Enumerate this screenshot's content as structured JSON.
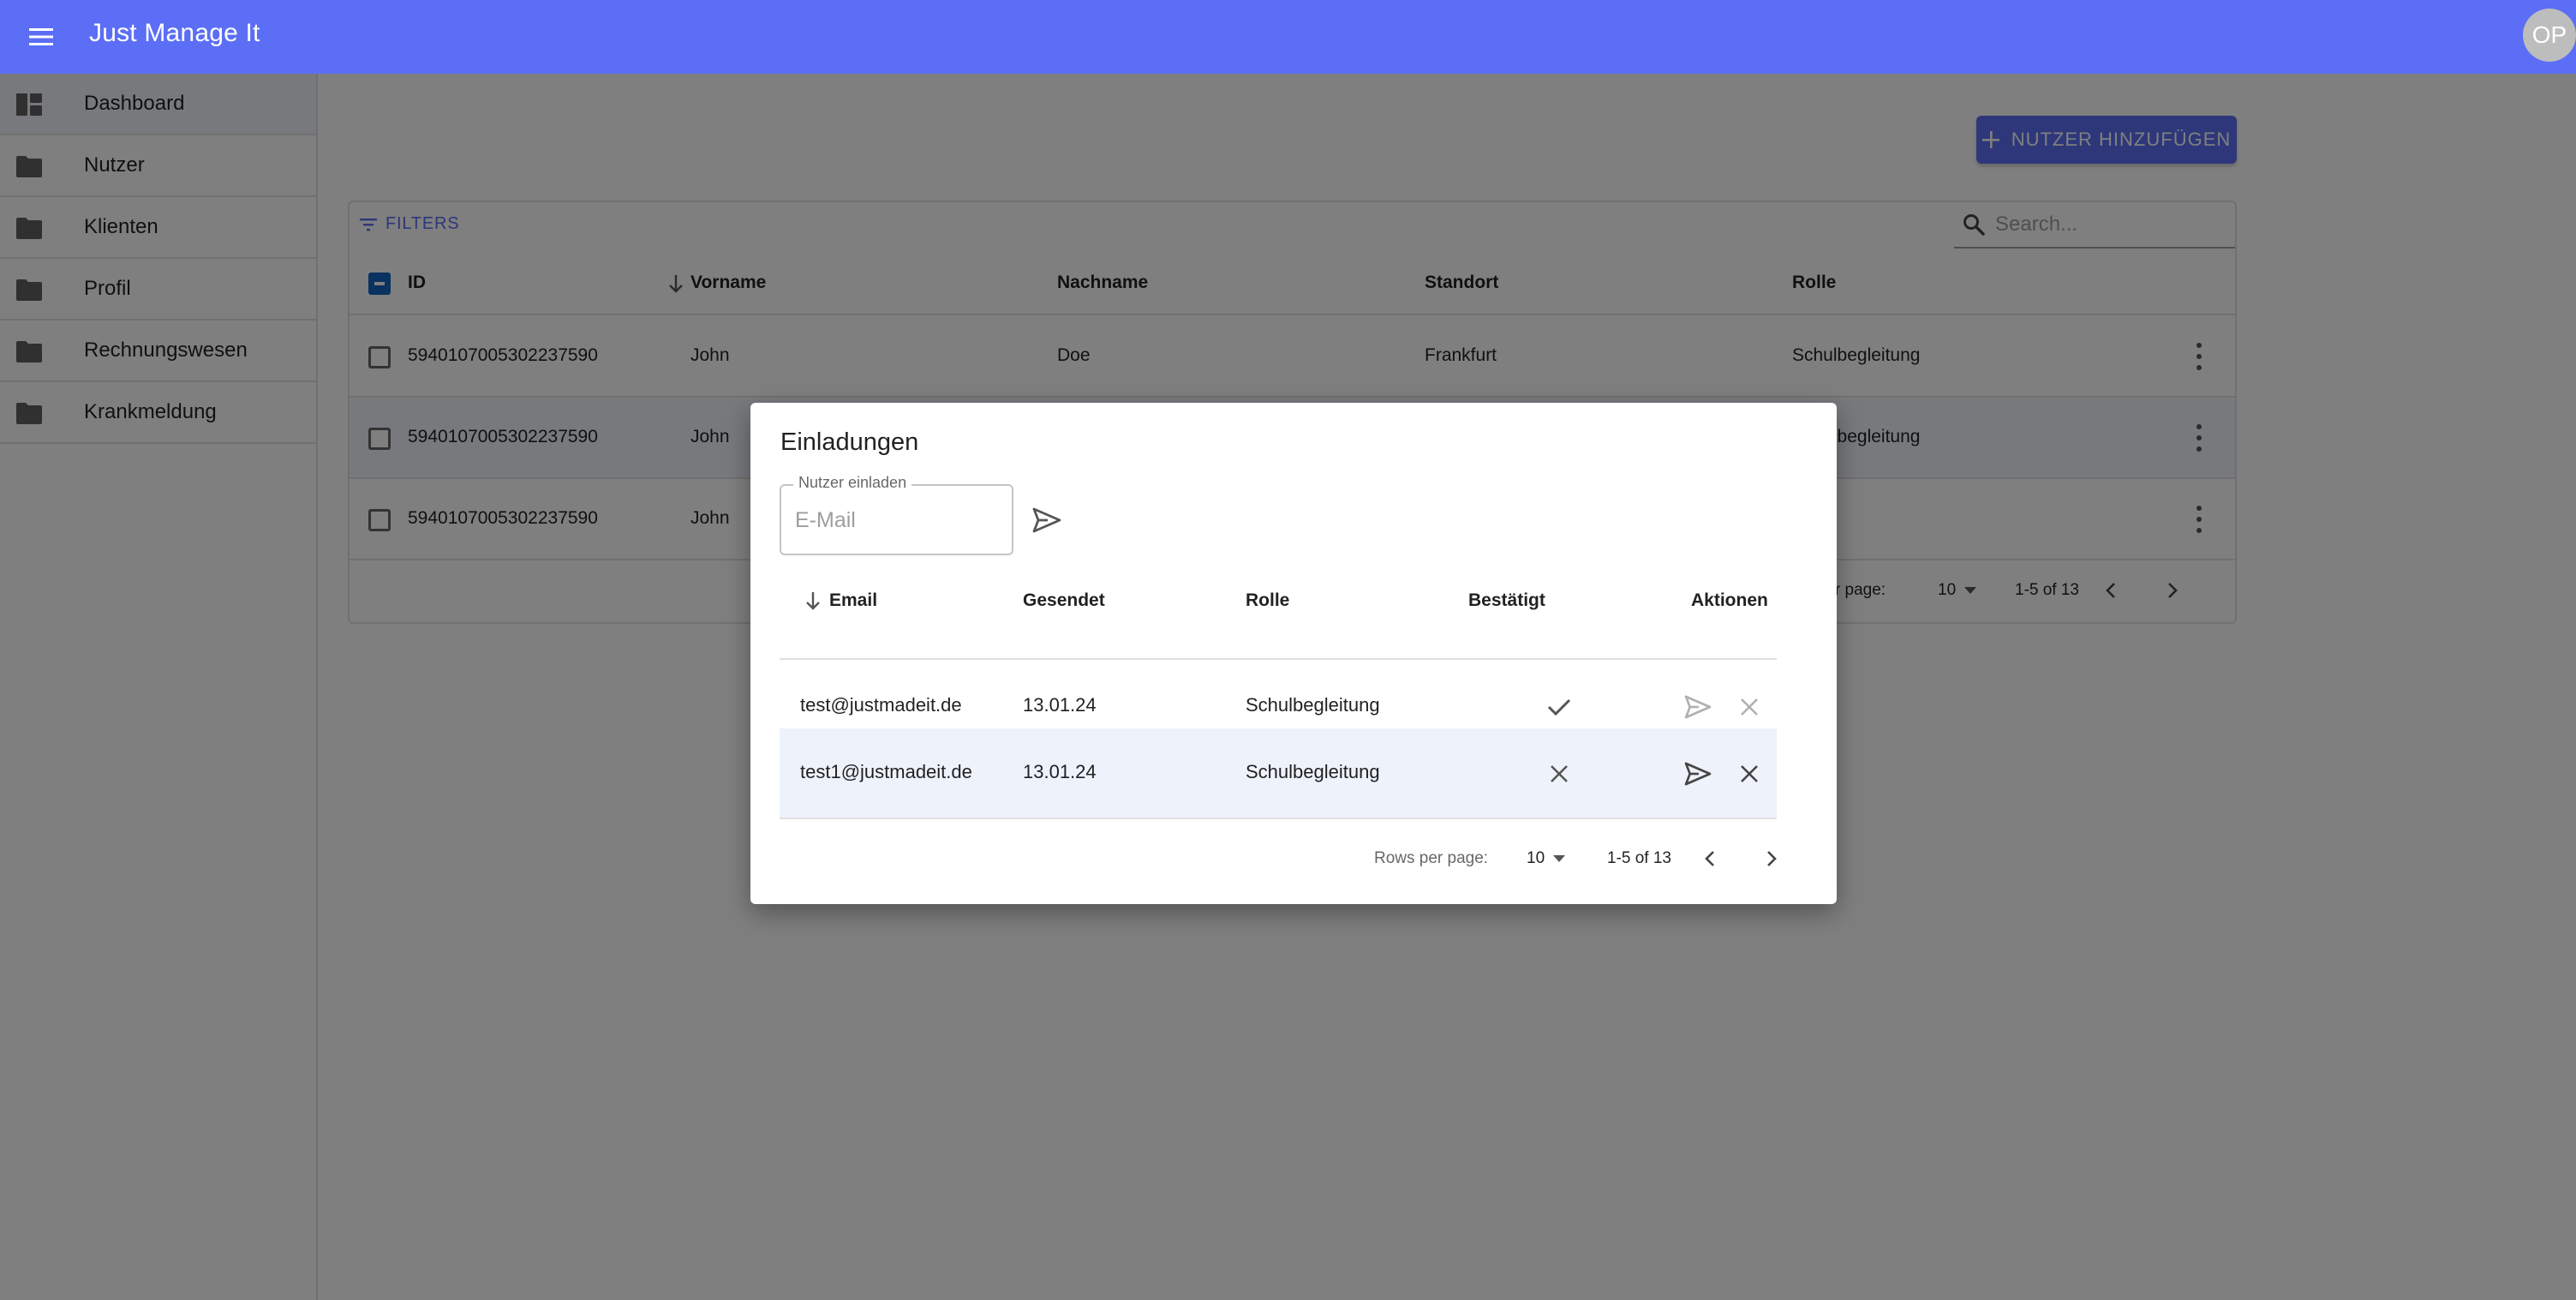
{
  "app": {
    "title": "Just Manage It",
    "avatar_initials": "OP",
    "accent_color": "#5b6ef5"
  },
  "sidebar": {
    "items": [
      {
        "label": "Dashboard",
        "icon": "dashboard-icon",
        "active": true
      },
      {
        "label": "Nutzer",
        "icon": "folder-icon"
      },
      {
        "label": "Klienten",
        "icon": "folder-icon"
      },
      {
        "label": "Profil",
        "icon": "folder-icon"
      },
      {
        "label": "Rechnungswesen",
        "icon": "folder-icon"
      },
      {
        "label": "Krankmeldung",
        "icon": "folder-icon"
      }
    ]
  },
  "main": {
    "add_button_label": "NUTZER HINZUFÜGEN",
    "filters_label": "FILTERS",
    "search_placeholder": "Search...",
    "columns": [
      "ID",
      "Vorname",
      "Nachname",
      "Standort",
      "Rolle"
    ],
    "rows": [
      {
        "id": "5940107005302237590",
        "vorname": "John",
        "nachname": "Doe",
        "standort": "Frankfurt",
        "rolle": "Schulbegleitung"
      },
      {
        "id": "5940107005302237590",
        "vorname": "John",
        "nachname": "",
        "standort": "",
        "rolle": "Schulbegleitung"
      },
      {
        "id": "5940107005302237590",
        "vorname": "John",
        "nachname": "",
        "standort": "",
        "rolle": ""
      }
    ],
    "footer": {
      "rows_per_page_label": "Rows per page:",
      "rows_per_page_value": "10",
      "range": "1-5 of 13"
    }
  },
  "dialog": {
    "title": "Einladungen",
    "invite_label": "Nutzer einladen",
    "invite_placeholder": "E-Mail",
    "columns": {
      "email": "Email",
      "sent": "Gesendet",
      "role": "Rolle",
      "confirmed": "Bestätigt",
      "actions": "Aktionen"
    },
    "rows": [
      {
        "email": "test@justmadeit.de",
        "sent": "13.01.24",
        "role": "Schulbegleitung",
        "confirmed": true
      },
      {
        "email": "test1@justmadeit.de",
        "sent": "13.01.24",
        "role": "Schulbegleitung",
        "confirmed": false
      }
    ],
    "footer": {
      "rows_per_page_label": "Rows per page:",
      "rows_per_page_value": "10",
      "range": "1-5 of 13"
    }
  }
}
